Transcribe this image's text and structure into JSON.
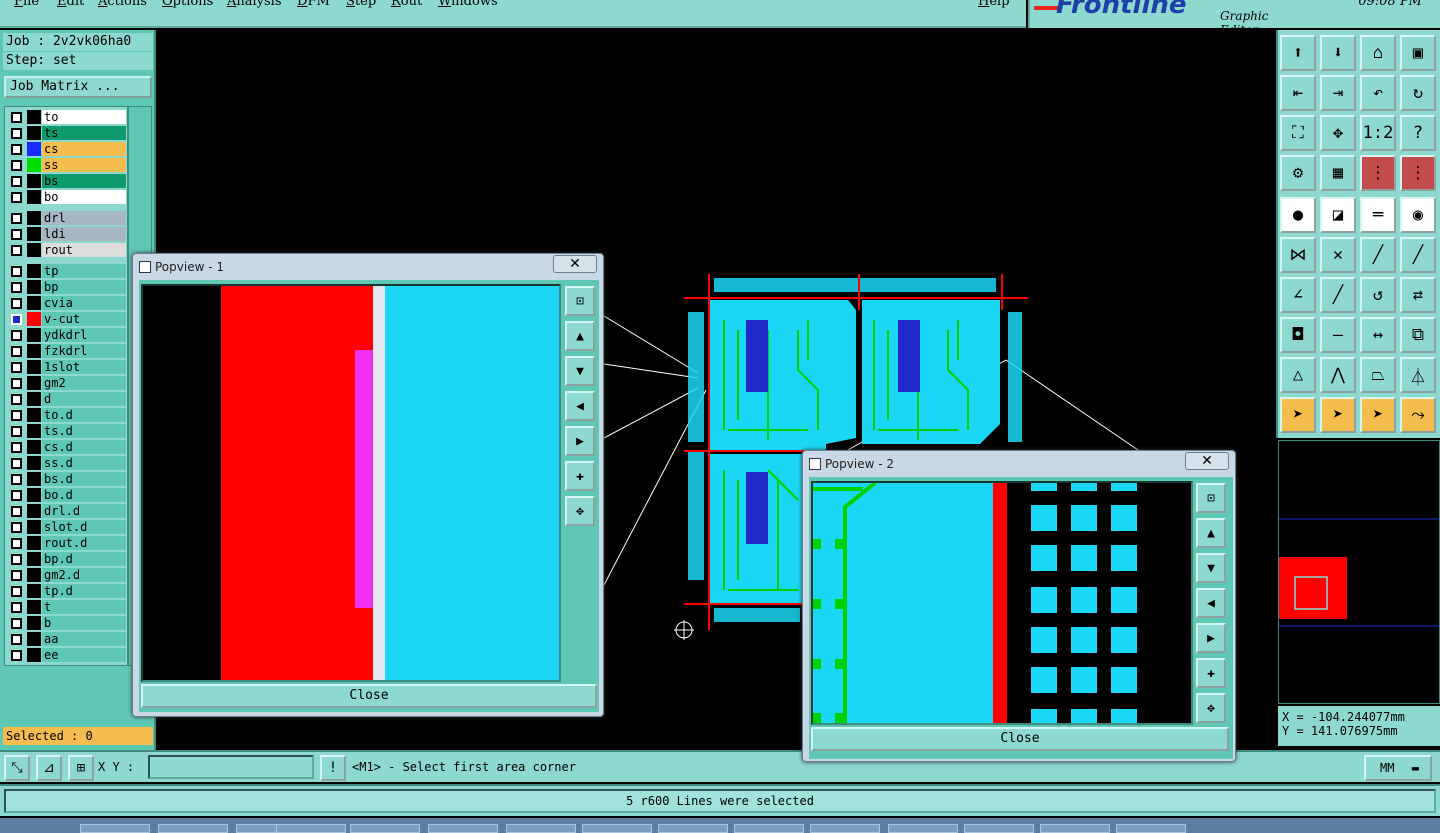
{
  "menu": {
    "items": [
      "File",
      "Edit",
      "Actions",
      "Options",
      "Analysis",
      "DFM",
      "Step",
      "Rout",
      "Windows"
    ],
    "help": "Help"
  },
  "logo": {
    "brand": "Frontline",
    "subtitle": "Graphic Editor"
  },
  "clock": "09:08 PM",
  "job": {
    "name": "Job : 2v2vk06ha0",
    "step": "Step: set",
    "matrix_button": "Job Matrix ..."
  },
  "layers": [
    {
      "name": "to",
      "color": "#ffffff",
      "swatch": "#000000"
    },
    {
      "name": "ts",
      "color": "#0d9b6e",
      "swatch": "#000000"
    },
    {
      "name": "cs",
      "color": "#f5bd4d",
      "swatch": "#1a2bff"
    },
    {
      "name": "ss",
      "color": "#f5bd4d",
      "swatch": "#00e000"
    },
    {
      "name": "bs",
      "color": "#0d9b6e",
      "swatch": "#000000"
    },
    {
      "name": "bo",
      "color": "#ffffff",
      "swatch": "#000000"
    },
    {
      "name": "drl",
      "color": "#a7b8c2",
      "swatch": "#000000"
    },
    {
      "name": "ldi",
      "color": "#a7b8c2",
      "swatch": "#000000"
    },
    {
      "name": "rout",
      "color": "#dddddd",
      "swatch": "#000000"
    },
    {
      "name": "tp",
      "color": "#5fc8b5",
      "swatch": "#000000"
    },
    {
      "name": "bp",
      "color": "#5fc8b5",
      "swatch": "#000000"
    },
    {
      "name": "cvia",
      "color": "#5fc8b5",
      "swatch": "#000000"
    },
    {
      "name": "v-cut",
      "color": "#5fc8b5",
      "swatch": "#ff0000",
      "active": true
    },
    {
      "name": "ydkdrl",
      "color": "#5fc8b5",
      "swatch": "#000000"
    },
    {
      "name": "fzkdrl",
      "color": "#5fc8b5",
      "swatch": "#000000"
    },
    {
      "name": "1slot",
      "color": "#5fc8b5",
      "swatch": "#000000"
    },
    {
      "name": "gm2",
      "color": "#5fc8b5",
      "swatch": "#000000"
    },
    {
      "name": "d",
      "color": "#5fc8b5",
      "swatch": "#000000"
    },
    {
      "name": "to.d",
      "color": "#5fc8b5",
      "swatch": "#000000"
    },
    {
      "name": "ts.d",
      "color": "#5fc8b5",
      "swatch": "#000000"
    },
    {
      "name": "cs.d",
      "color": "#5fc8b5",
      "swatch": "#000000"
    },
    {
      "name": "ss.d",
      "color": "#5fc8b5",
      "swatch": "#000000"
    },
    {
      "name": "bs.d",
      "color": "#5fc8b5",
      "swatch": "#000000"
    },
    {
      "name": "bo.d",
      "color": "#5fc8b5",
      "swatch": "#000000"
    },
    {
      "name": "drl.d",
      "color": "#5fc8b5",
      "swatch": "#000000"
    },
    {
      "name": "slot.d",
      "color": "#5fc8b5",
      "swatch": "#000000"
    },
    {
      "name": "rout.d",
      "color": "#5fc8b5",
      "swatch": "#000000"
    },
    {
      "name": "bp.d",
      "color": "#5fc8b5",
      "swatch": "#000000"
    },
    {
      "name": "gm2.d",
      "color": "#5fc8b5",
      "swatch": "#000000"
    },
    {
      "name": "tp.d",
      "color": "#5fc8b5",
      "swatch": "#000000"
    },
    {
      "name": "t",
      "color": "#5fc8b5",
      "swatch": "#000000"
    },
    {
      "name": "b",
      "color": "#5fc8b5",
      "swatch": "#000000"
    },
    {
      "name": "aa",
      "color": "#5fc8b5",
      "swatch": "#000000"
    },
    {
      "name": "ee",
      "color": "#5fc8b5",
      "swatch": "#000000"
    }
  ],
  "selected": "Selected : 0",
  "popup1": {
    "title": "Popview - 1",
    "close_x": "✕",
    "close_label": "Close"
  },
  "popup2": {
    "title": "Popview - 2",
    "close_x": "✕",
    "close_label": "Close"
  },
  "coords": {
    "x": "X = -104.244077mm",
    "y": "Y = 141.076975mm"
  },
  "command": {
    "xy_label": "X Y :",
    "xy_value": "",
    "prompt": "<M1> - Select first area corner",
    "unit": "MM"
  },
  "status": "5 r600 Lines were selected",
  "colors": {
    "panel": "#8ed9cf",
    "panel_dark": "#5fc8b5",
    "copper": "#1ad8f5",
    "vcut": "#ff0000",
    "accent": "#f5bd4d"
  }
}
